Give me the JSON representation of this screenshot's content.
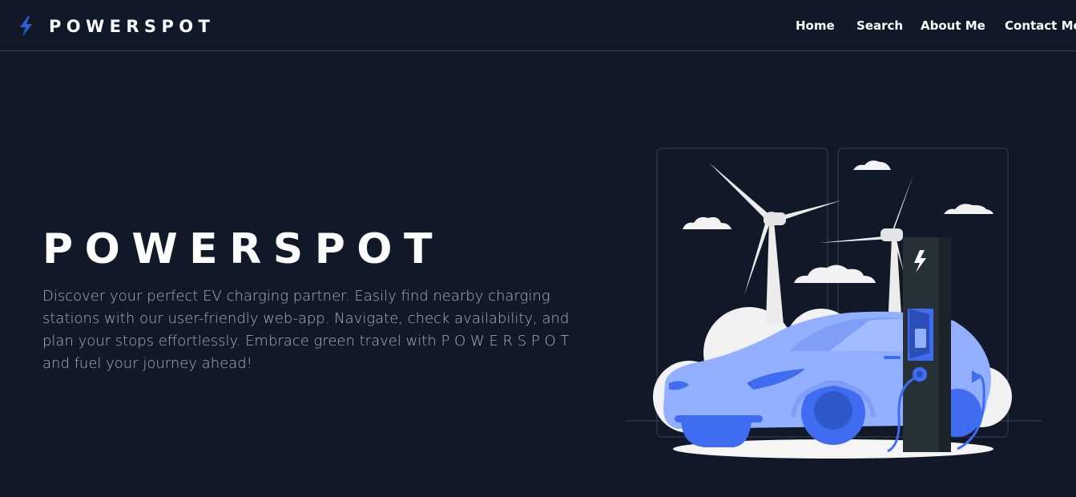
{
  "header": {
    "brand": "POWERSPOT",
    "logo_icon": "lightning-bolt-icon",
    "accent": "#2f5bd3",
    "nav": [
      {
        "label": "Home"
      },
      {
        "label": "Search"
      },
      {
        "label": "About Me"
      },
      {
        "label": "Contact Me"
      }
    ]
  },
  "hero": {
    "title": "POWERSPOT",
    "description": "Discover your perfect EV charging partner. Easily find nearby charging stations with our user-friendly web-app. Navigate, check availability, and plan your stops effortlessly. Embrace green travel with P O W E R S P O T and fuel your journey ahead!",
    "illustration": "ev-charging-car-illustration",
    "illustration_colors": {
      "car": "#92b0ff",
      "car_dark": "#3f6cf0",
      "charger": "#263238",
      "turbine": "#f0f0f0"
    }
  }
}
